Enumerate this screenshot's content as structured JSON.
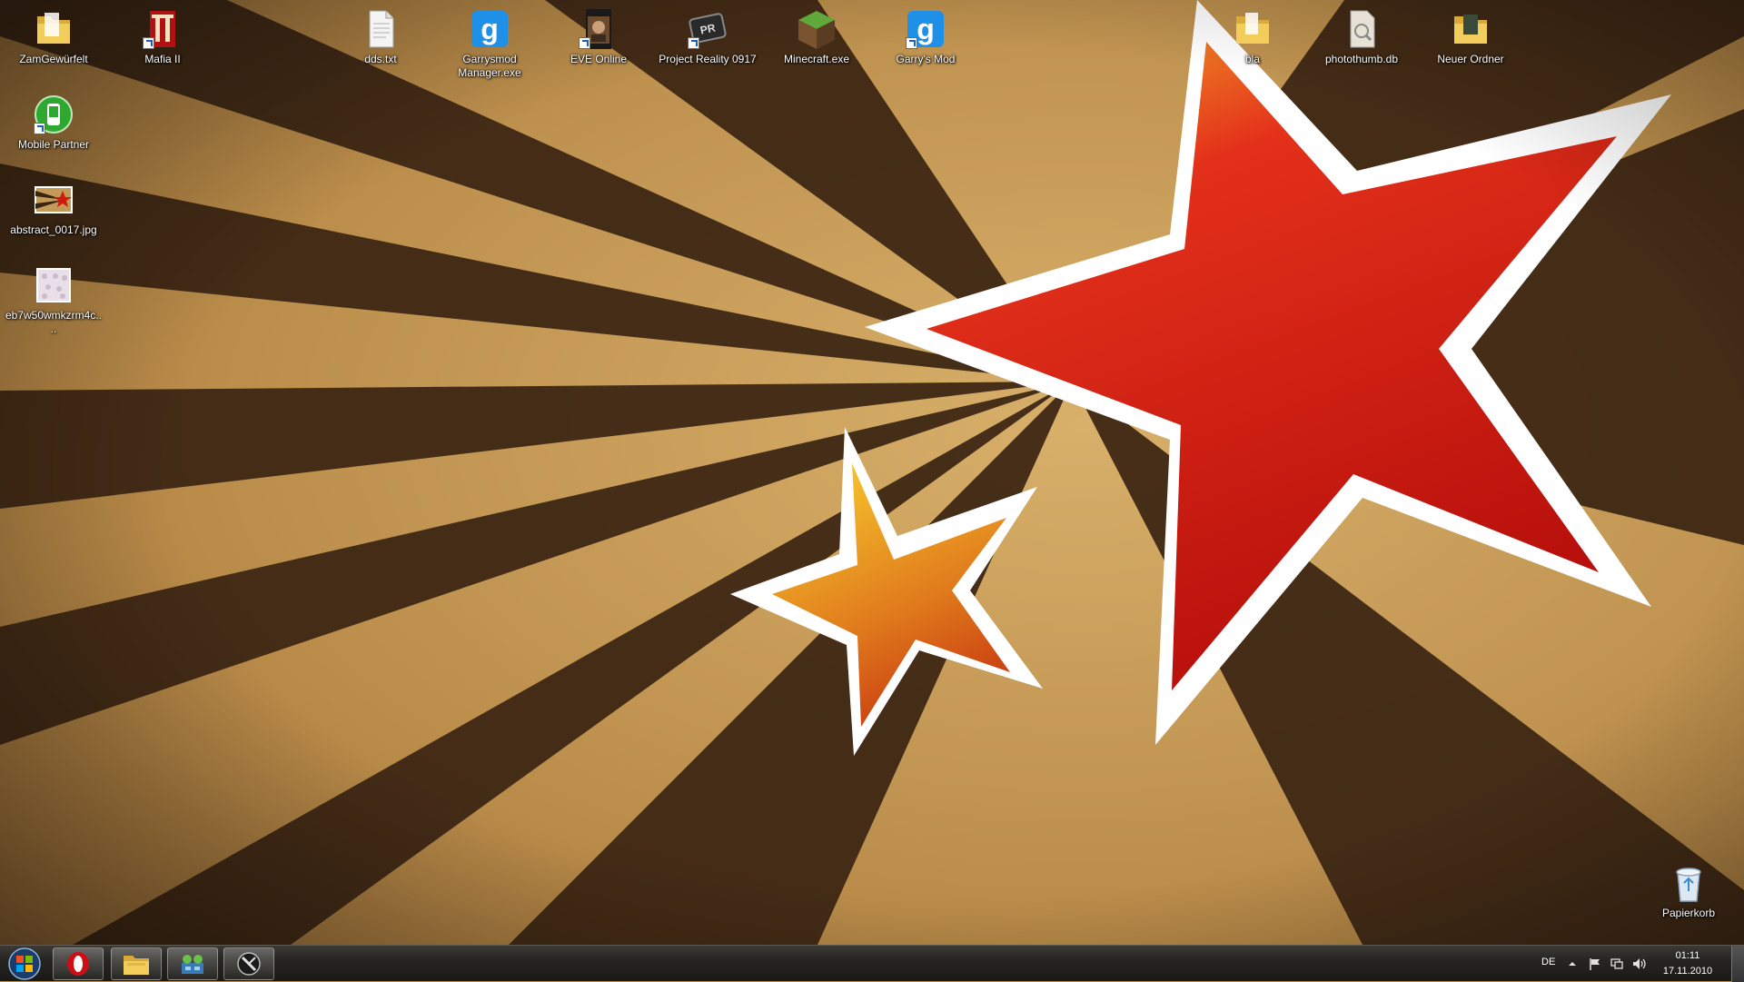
{
  "desktop": {
    "icons": [
      {
        "name": "desktop-icon-zamgewuerfelt",
        "label": "ZamGewürfelt",
        "icon": "folder-icon"
      },
      {
        "name": "desktop-icon-mafia-ii",
        "label": "Mafia II",
        "icon": "mafia-icon"
      },
      {
        "name": "desktop-icon-dds-txt",
        "label": "dds.txt",
        "icon": "text-file-icon"
      },
      {
        "name": "desktop-icon-garrysmod-manager",
        "label": "Garrysmod Manager.exe",
        "icon": "garrysmod-icon"
      },
      {
        "name": "desktop-icon-eve-online",
        "label": "EVE Online",
        "icon": "eve-online-icon"
      },
      {
        "name": "desktop-icon-project-reality",
        "label": "Project Reality 0917",
        "icon": "project-reality-icon"
      },
      {
        "name": "desktop-icon-minecraft",
        "label": "Minecraft.exe",
        "icon": "minecraft-icon"
      },
      {
        "name": "desktop-icon-garrys-mod",
        "label": "Garry's Mod",
        "icon": "garrysmod-icon"
      },
      {
        "name": "desktop-icon-bla",
        "label": "bla",
        "icon": "folder-icon"
      },
      {
        "name": "desktop-icon-photothumb",
        "label": "photothumb.db",
        "icon": "database-file-icon"
      },
      {
        "name": "desktop-icon-neuer-ordner",
        "label": "Neuer Ordner",
        "icon": "folder-icon"
      },
      {
        "name": "desktop-icon-mobile-partner",
        "label": "Mobile Partner",
        "icon": "mobile-partner-icon"
      },
      {
        "name": "desktop-icon-abstract-jpg",
        "label": "abstract_0017.jpg",
        "icon": "image-file-icon"
      },
      {
        "name": "desktop-icon-eb7w50",
        "label": "eb7w50wmkzrm4c....",
        "icon": "image-file-icon"
      },
      {
        "name": "desktop-icon-papierkorb",
        "label": "Papierkorb",
        "icon": "recycle-bin-icon"
      }
    ]
  },
  "taskbar": {
    "start_icon": "windows-logo-icon",
    "pinned": [
      {
        "name": "taskbar-opera",
        "icon": "opera-icon"
      },
      {
        "name": "taskbar-explorer",
        "icon": "explorer-folder-icon"
      },
      {
        "name": "taskbar-network-app",
        "icon": "network-app-icon"
      },
      {
        "name": "taskbar-tool-app",
        "icon": "tool-app-icon"
      }
    ],
    "tray": {
      "language": "DE",
      "time": "01:11",
      "date": "17.11.2010"
    }
  },
  "colors": {
    "wallpaper_tan": "#c49a58",
    "wallpaper_dark": "#3a2412",
    "star_red": "#d01a10",
    "star_orange": "#f0a020",
    "taskbar": "#262522"
  }
}
